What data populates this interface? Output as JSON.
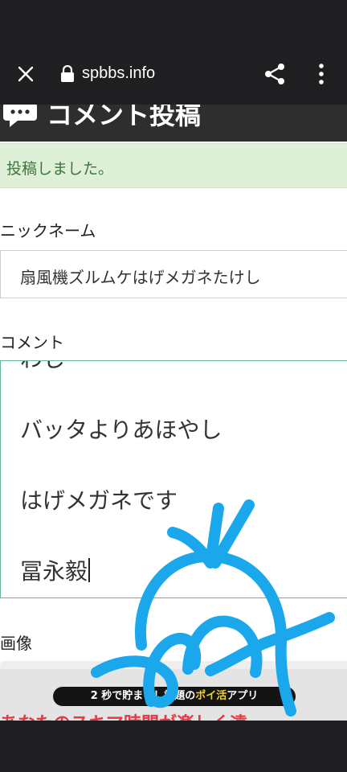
{
  "browser": {
    "url": "spbbs.info"
  },
  "section": {
    "title": "コメント投稿"
  },
  "notice": {
    "message": "投稿しました。"
  },
  "form": {
    "nickname_label": "ニックネーム",
    "nickname_value": "扇風機ズルムケはげメガネたけし",
    "comment_label": "コメント",
    "comment_lines": [
      "わし",
      "バッタよりあほやし",
      "はげメガネです",
      "冨永毅"
    ],
    "image_label": "画像"
  },
  "ad": {
    "pill_prefix": "2 秒で貯まる！話題の",
    "pill_accent": "ポイ活",
    "pill_suffix": "アプリ",
    "headline": "あなたのスキマ時間が楽しく遠"
  },
  "colors": {
    "scribble": "#1aa7ec",
    "notice_bg": "#dff0d8",
    "comment_border": "#5fb89a"
  },
  "icons": [
    "close-icon",
    "lock-icon",
    "share-icon",
    "more-vert-icon",
    "chat-icon"
  ]
}
